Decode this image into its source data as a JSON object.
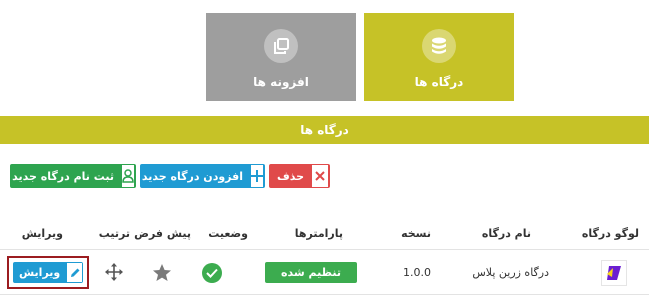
{
  "tiles": {
    "gateways": {
      "label": "درگاه ها",
      "icon": "database-icon"
    },
    "addons": {
      "label": "افزونه ها",
      "icon": "copy-icon"
    }
  },
  "section_title": "درگاه ها",
  "toolbar": {
    "delete_label": "حذف",
    "add_gateway_label": "افزودن درگاه جدید",
    "register_name_label": "ثبت نام درگاه جدید"
  },
  "table": {
    "headers": {
      "logo": "لوگو درگاه",
      "name": "نام درگاه",
      "version": "نسخه",
      "params": "پارامترها",
      "status": "وضعیت",
      "default": "پیش فرض",
      "order": "ترتیب",
      "edit": "ویرایش"
    },
    "rows": [
      {
        "name": "درگاه زرین پلاس",
        "version": "1.0.0",
        "params_label": "تنظیم شده",
        "edit_label": "ویرایش"
      }
    ]
  },
  "colors": {
    "accent": "#c6c227",
    "gray_tile": "#9e9e9e",
    "danger": "#e04a4a",
    "primary": "#1f9bd3",
    "success": "#2ea44f",
    "highlight_border": "#9b1c20"
  }
}
